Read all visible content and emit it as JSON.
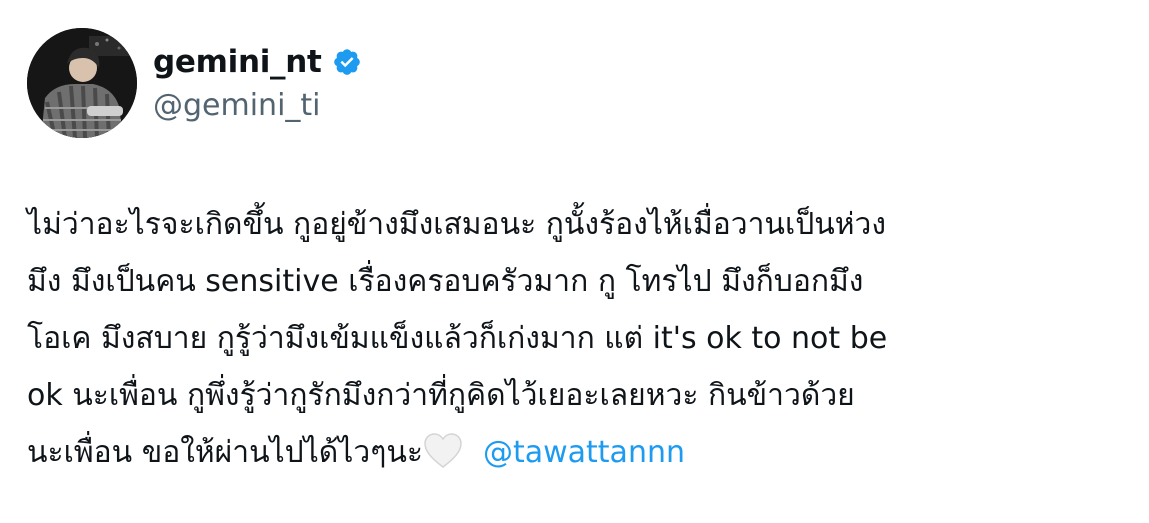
{
  "author": {
    "display_name": "gemini_nt",
    "handle": "@gemini_ti",
    "verified_icon": "verified-badge-icon",
    "avatar": "profile-photo"
  },
  "tweet": {
    "lines": [
      "ไม่ว่าอะไรจะเกิดขึ้น กูอยู่ข้างมึงเสมอนะ กูนั้งร้องไห้เมื่อวานเป็นห่วง",
      "มึง มึงเป็นคน sensitive เรื่องครอบครัวมาก กู โทรไป มึงก็บอกมึง",
      "โอเค มึงสบาย กูรู้ว่ามึงเข้มแข็งแล้วก็เก่งมาก แต่ it's ok to not be",
      "ok นะเพื่อน กูพึ่งรู้ว่ากูรักมึงกว่าที่กูคิดไว้เยอะเลยหวะ กินข้าวด้วย"
    ],
    "last_line_text": "นะเพื่อน ขอให้ผ่านไปได้ไวๆนะ",
    "emoji": "white-heart-icon",
    "mention": "@tawattannn"
  },
  "colors": {
    "text": "#0f1419",
    "secondary": "#536471",
    "accent": "#1d9bf0"
  }
}
